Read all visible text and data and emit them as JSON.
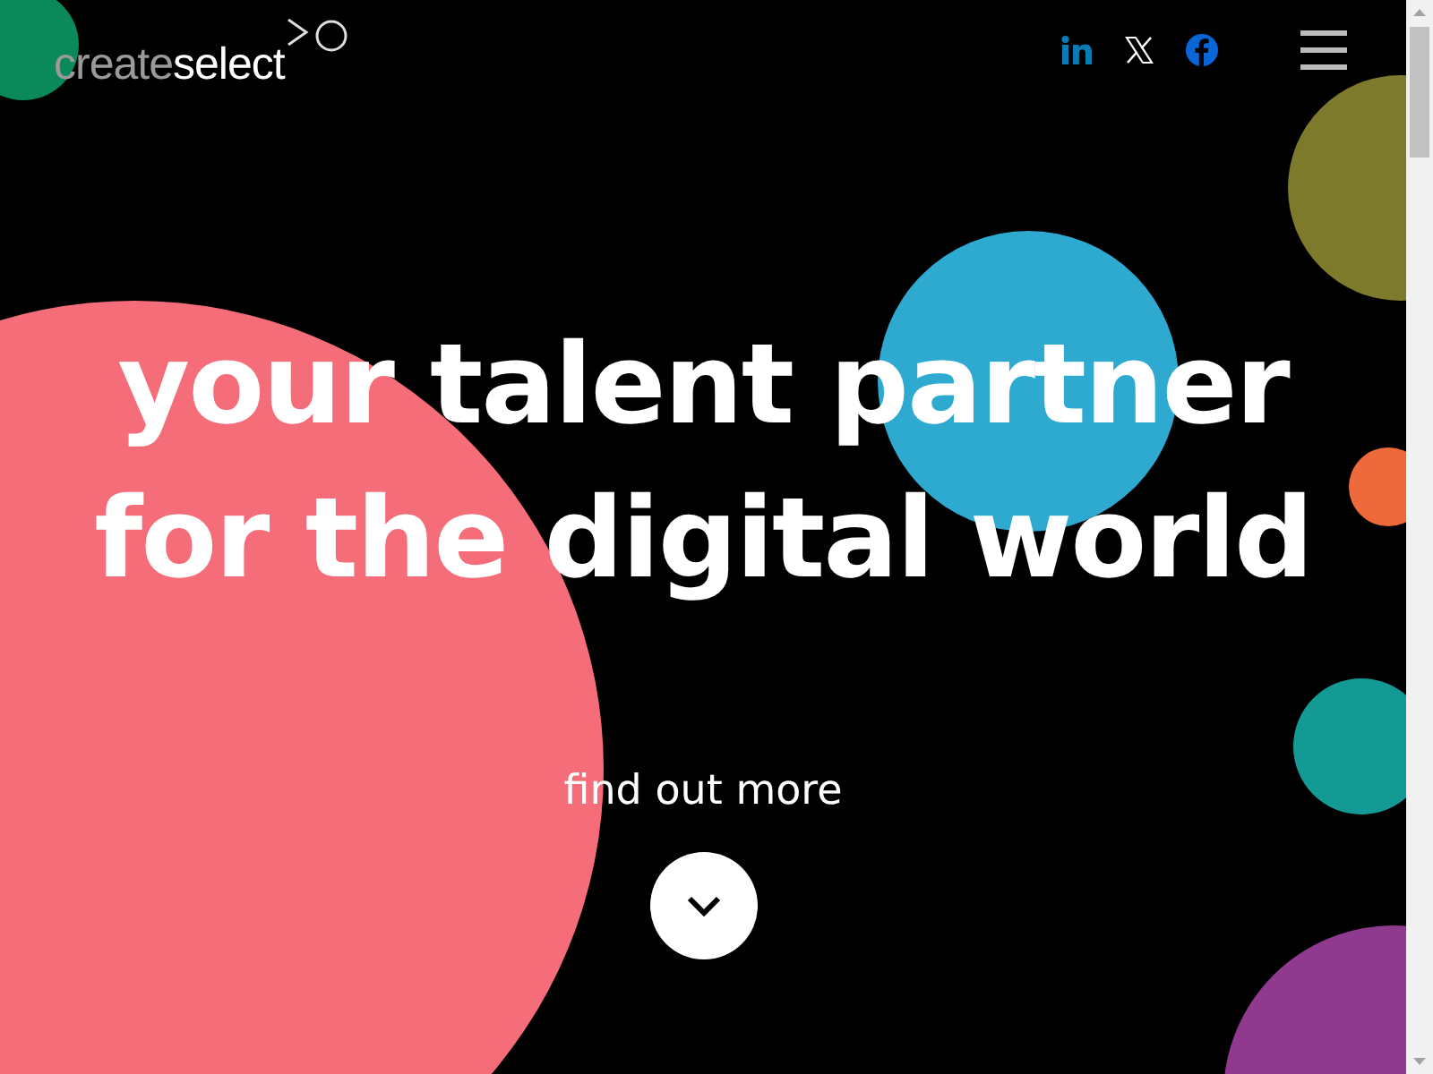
{
  "logo": {
    "first": "create",
    "second": "select"
  },
  "social_links": [
    {
      "kind": "linkedin"
    },
    {
      "kind": "x"
    },
    {
      "kind": "facebook"
    }
  ],
  "hero": {
    "headline_lines": [
      "your talent partner",
      "for the digital world"
    ],
    "cta": "find out more"
  }
}
